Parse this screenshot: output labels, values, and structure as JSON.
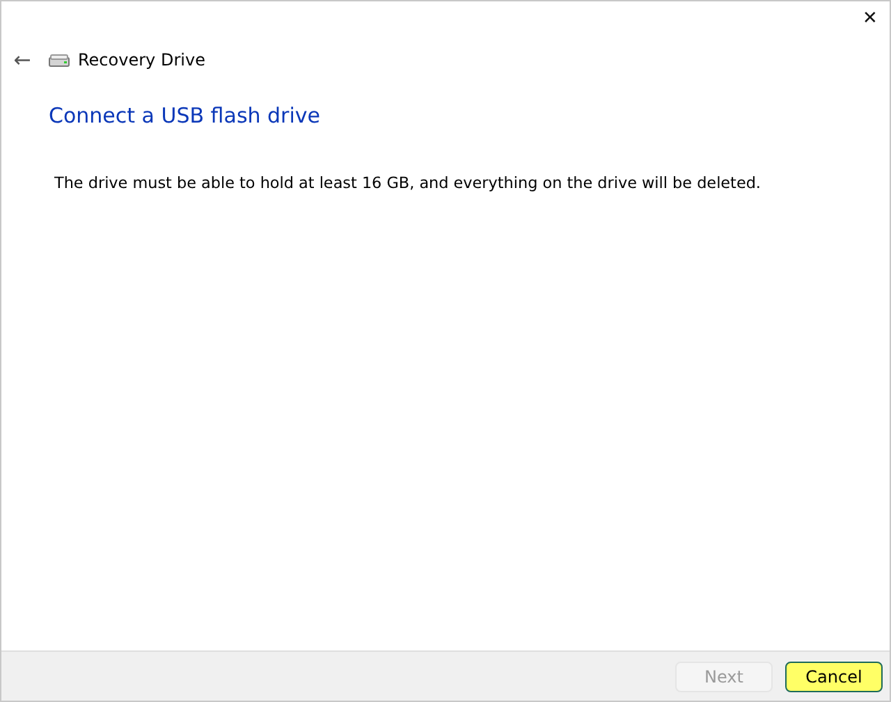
{
  "window": {
    "close": "✕"
  },
  "header": {
    "back": "←",
    "title": "Recovery Drive"
  },
  "heading": "Connect a USB flash drive",
  "message": "The drive must be able to hold at least 16 GB, and everything on the drive will be deleted.",
  "buttons": [
    {
      "label": "Next",
      "disabled": true,
      "highlighted": false
    },
    {
      "label": "Cancel",
      "disabled": false,
      "highlighted": true
    }
  ]
}
